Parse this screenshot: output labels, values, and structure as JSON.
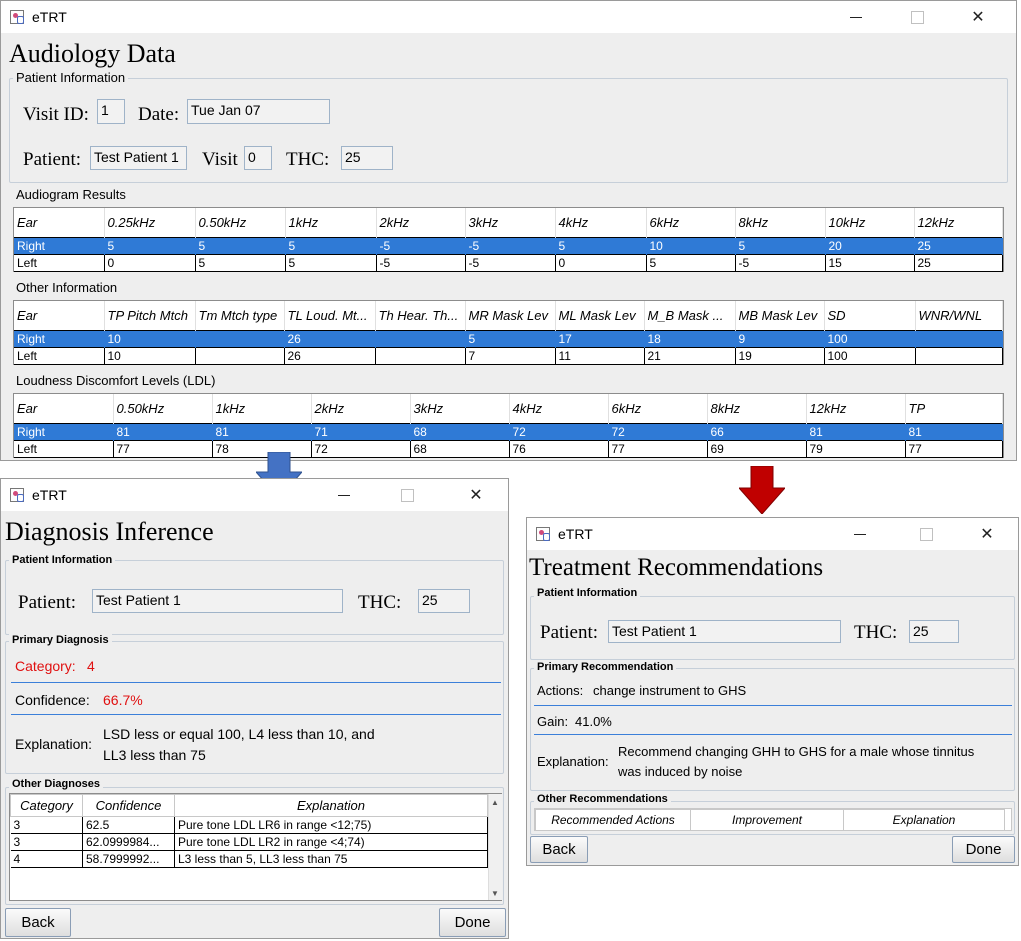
{
  "app_title": "eTRT",
  "audiology": {
    "title": "Audiology Data",
    "patient_info_label": "Patient Information",
    "visit_id_label": "Visit ID:",
    "visit_id": "1",
    "date_label": "Date:",
    "date": "Tue Jan 07",
    "patient_label": "Patient:",
    "patient": "Test  Patient 1",
    "visit_label": "Visit",
    "visit": "0",
    "thc_label": "THC:",
    "thc": "25",
    "audiogram_label": "Audiogram Results",
    "audiogram": {
      "headers": [
        "Ear",
        "0.25kHz",
        "0.50kHz",
        "1kHz",
        "2kHz",
        "3kHz",
        "4kHz",
        "6kHz",
        "8kHz",
        "10kHz",
        "12kHz"
      ],
      "rows": [
        [
          "Right",
          "5",
          "5",
          "5",
          "-5",
          "-5",
          "5",
          "10",
          "5",
          "20",
          "25"
        ],
        [
          "Left",
          "0",
          "5",
          "5",
          "-5",
          "-5",
          "0",
          "5",
          "-5",
          "15",
          "25"
        ]
      ]
    },
    "other_label": "Other Information",
    "other": {
      "headers": [
        "Ear",
        "TP Pitch Mtch",
        "Tm Mtch type",
        "TL Loud. Mt...",
        "Th Hear. Th...",
        "MR Mask Lev",
        "ML Mask Lev",
        "M_B Mask ...",
        "MB Mask Lev",
        "SD",
        "WNR/WNL"
      ],
      "rows": [
        [
          "Right",
          "10",
          "",
          "26",
          "",
          "5",
          "17",
          "18",
          "9",
          "100",
          ""
        ],
        [
          "Left",
          "10",
          "",
          "26",
          "",
          "7",
          "11",
          "21",
          "19",
          "100",
          ""
        ]
      ]
    },
    "ldl_label": "Loudness Discomfort Levels (LDL)",
    "ldl": {
      "headers": [
        "Ear",
        "0.50kHz",
        "1kHz",
        "2kHz",
        "3kHz",
        "4kHz",
        "6kHz",
        "8kHz",
        "12kHz",
        "TP"
      ],
      "rows": [
        [
          "Right",
          "81",
          "81",
          "71",
          "68",
          "72",
          "72",
          "66",
          "81",
          "81"
        ],
        [
          "Left",
          "77",
          "78",
          "72",
          "68",
          "76",
          "77",
          "69",
          "79",
          "77"
        ]
      ]
    }
  },
  "diagnosis": {
    "title": "Diagnosis Inference",
    "patient_info_label": "Patient Information",
    "patient_label": "Patient:",
    "patient": "Test  Patient 1",
    "thc_label": "THC:",
    "thc": "25",
    "primary_label": "Primary Diagnosis",
    "category_label": "Category:",
    "category": "4",
    "confidence_label": "Confidence:",
    "confidence": "66.7%",
    "explanation_label": "Explanation:",
    "explanation_line1": "LSD less or equal 100, L4 less than 10, and",
    "explanation_line2": "LL3 less than 75",
    "other_label": "Other Diagnoses",
    "table": {
      "headers": [
        "Category",
        "Confidence",
        "Explanation"
      ],
      "rows": [
        [
          "3",
          "62.5",
          "Pure tone LDL LR6 in range <12;75)"
        ],
        [
          "3",
          "62.0999984...",
          "Pure tone LDL LR2 in range <4;74)"
        ],
        [
          "4",
          "58.7999992...",
          "L3 less than 5, LL3 less than 75"
        ]
      ]
    },
    "back": "Back",
    "done": "Done"
  },
  "treatment": {
    "title": "Treatment Recommendations",
    "patient_info_label": "Patient Information",
    "patient_label": "Patient:",
    "patient": "Test  Patient 1",
    "thc_label": "THC:",
    "thc": "25",
    "primary_label": "Primary Recommendation",
    "actions_label": "Actions:",
    "actions": "change instrument to GHS",
    "gain_label": "Gain:",
    "gain": "41.0%",
    "explanation_label": "Explanation:",
    "explanation_line1": "Recommend changing GHH to GHS for a male whose tinnitus",
    "explanation_line2": "was induced by noise",
    "other_label": "Other Recommendations",
    "table_headers": [
      "Recommended Actions",
      "Improvement",
      "Explanation"
    ],
    "back": "Back",
    "done": "Done"
  },
  "colors": {
    "selection": "#2f7ad6",
    "emphasis": "#e01010",
    "arrow_blue": "#4472c4",
    "arrow_red": "#c00000"
  }
}
